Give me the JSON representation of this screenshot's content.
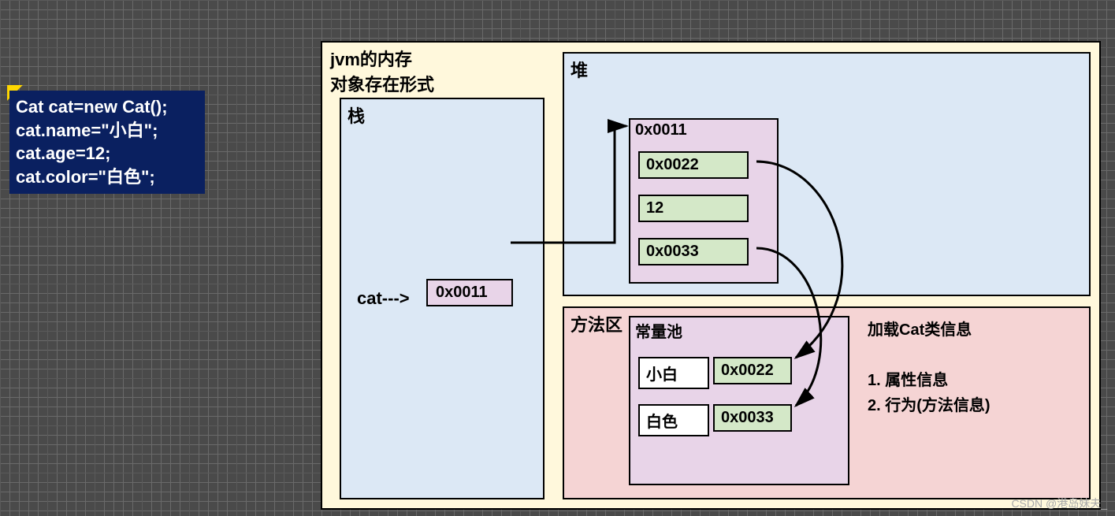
{
  "code": {
    "line1": "Cat cat=new Cat();",
    "line2": "cat.name=\"小白\";",
    "line3": "cat.age=12;",
    "line4": "cat.color=\"白色\";"
  },
  "main": {
    "title1": "jvm的内存",
    "title2": "对象存在形式"
  },
  "stack": {
    "title": "栈",
    "var_label": "cat--->",
    "address": "0x0011"
  },
  "heap": {
    "title": "堆",
    "object_address": "0x0011",
    "fields": {
      "name_ref": "0x0022",
      "age_value": "12",
      "color_ref": "0x0033"
    }
  },
  "method_area": {
    "title": "方法区",
    "pool": {
      "title": "常量池",
      "entry1": {
        "value": "小白",
        "address": "0x0022"
      },
      "entry2": {
        "value": "白色",
        "address": "0x0033"
      }
    },
    "class_info": {
      "heading": "加载Cat类信息",
      "item1": "1. 属性信息",
      "item2": "2. 行为(方法信息)"
    }
  },
  "watermark": "CSDN @港岛妹夫_"
}
